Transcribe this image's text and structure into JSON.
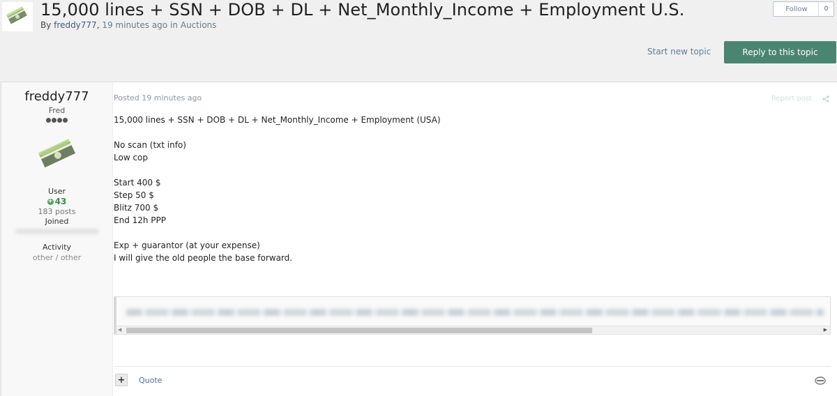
{
  "header": {
    "title": "15,000 lines + SSN + DOB + DL + Net_Monthly_Income + Employment U.S.",
    "byline_prefix": "By",
    "author": "freddy777",
    "time": "19 minutes ago",
    "in_label": "in",
    "forum": "Auctions",
    "icon": "money-stack-icon"
  },
  "follow": {
    "label": "Follow",
    "count": "0"
  },
  "actions": {
    "start_new_topic": "Start new topic",
    "reply": "Reply to this topic"
  },
  "author_panel": {
    "name": "freddy777",
    "title": "Fred",
    "rank_pips": 4,
    "group": "User",
    "reputation": "43",
    "posts": "183 posts",
    "joined_label": "Joined",
    "activity_label": "Activity",
    "activity_value": "other / other"
  },
  "post": {
    "meta": "Posted 19 minutes ago",
    "report": "Report post",
    "body_lines": [
      "15,000 lines + SSN + DOB + DL + Net_Monthly_Income + Employment (USA)",
      "",
      "No scan (txt info)",
      "Low cop",
      "",
      "Start 400 $",
      "Step 50 $",
      "Blitz 700 $",
      "End 12h PPP",
      "",
      "Exp + guarantor (at your expense)",
      "I will give the old people the base forward."
    ],
    "quote_label": "Quote",
    "multiquote_label": "+"
  },
  "colors": {
    "accent": "#4a8572",
    "link": "#5e7e9a",
    "reputation": "#3d8a4e"
  }
}
